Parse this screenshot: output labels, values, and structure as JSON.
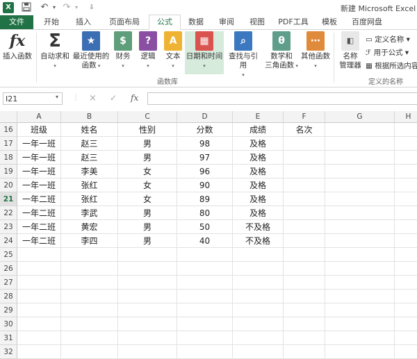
{
  "title": "新建 Microsoft Excel 工",
  "quick_access": {
    "app_icon": "excel-logo",
    "save_icon": "save-icon",
    "undo_icon": "undo-icon",
    "redo_icon": "redo-icon"
  },
  "tabs": [
    "文件",
    "开始",
    "插入",
    "页面布局",
    "公式",
    "数据",
    "审阅",
    "视图",
    "PDF工具",
    "模板",
    "百度网盘"
  ],
  "active_tab": "公式",
  "ribbon": {
    "insert_function": "插入函数",
    "autosum": "自动求和",
    "recent_line1": "最近使用的",
    "recent_line2": "函数",
    "finance": "财务",
    "logic": "逻辑",
    "text": "文本",
    "datetime": "日期和时间",
    "lookup": "查找与引用",
    "math_line1": "数学和",
    "math_line2": "三角函数",
    "other": "其他函数",
    "group_library": "函数库",
    "name_manager_line1": "名称",
    "name_manager_line2": "管理器",
    "define_name": "定义名称",
    "use_in_formula": "用于公式",
    "create_from_selection": "根据所选内容",
    "group_defined_names": "定义的名称"
  },
  "formula_bar": {
    "name_box": "I21",
    "cancel": "×",
    "enter": "✓",
    "fx": "fx",
    "content": ""
  },
  "columns": [
    "A",
    "B",
    "C",
    "D",
    "E",
    "F",
    "G",
    "H"
  ],
  "rows": [
    {
      "num": "16",
      "cells": [
        "班级",
        "姓名",
        "性别",
        "分数",
        "成绩",
        "名次"
      ]
    },
    {
      "num": "17",
      "cells": [
        "一年一班",
        "赵三",
        "男",
        "98",
        "及格",
        ""
      ]
    },
    {
      "num": "18",
      "cells": [
        "一年一班",
        "赵三",
        "男",
        "97",
        "及格",
        ""
      ]
    },
    {
      "num": "19",
      "cells": [
        "一年一班",
        "李美",
        "女",
        "96",
        "及格",
        ""
      ]
    },
    {
      "num": "20",
      "cells": [
        "一年一班",
        "张红",
        "女",
        "90",
        "及格",
        ""
      ]
    },
    {
      "num": "21",
      "cells": [
        "一年二班",
        "张红",
        "女",
        "89",
        "及格",
        ""
      ]
    },
    {
      "num": "22",
      "cells": [
        "一年二班",
        "李武",
        "男",
        "80",
        "及格",
        ""
      ]
    },
    {
      "num": "23",
      "cells": [
        "一年二班",
        "黄宏",
        "男",
        "50",
        "不及格",
        ""
      ]
    },
    {
      "num": "24",
      "cells": [
        "一年二班",
        "李四",
        "男",
        "40",
        "不及格",
        ""
      ]
    },
    {
      "num": "25",
      "cells": []
    },
    {
      "num": "26",
      "cells": []
    },
    {
      "num": "27",
      "cells": []
    },
    {
      "num": "28",
      "cells": []
    },
    {
      "num": "29",
      "cells": []
    },
    {
      "num": "30",
      "cells": []
    },
    {
      "num": "31",
      "cells": []
    },
    {
      "num": "32",
      "cells": []
    }
  ],
  "active_row": "21",
  "colors": {
    "excel_green": "#217346",
    "selected_ribbon": "#d6ebdc"
  }
}
